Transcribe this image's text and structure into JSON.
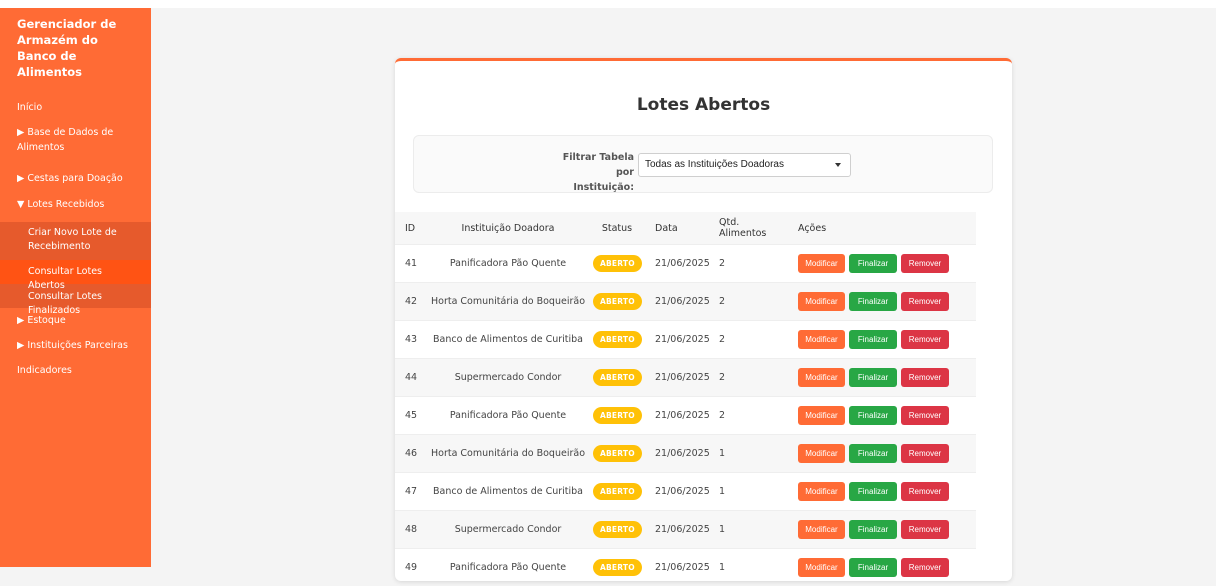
{
  "sidebar": {
    "brand": "Gerenciador de Armazém do Banco de Alimentos",
    "inicio": "Início",
    "base": "▶ Base de Dados de Alimentos",
    "cestas": "▶ Cestas para Doação",
    "lotes": "▼ Lotes Recebidos",
    "sub": [
      "Criar Novo Lote de Recebimento",
      "Consultar Lotes Abertos",
      "Consultar Lotes Finalizados"
    ],
    "estoque": "▶ Estoque",
    "instituicoes": "▶ Instituições Parceiras",
    "indicadores": "Indicadores"
  },
  "page": {
    "title": "Lotes Abertos",
    "filter_label": "Filtrar Tabela por Instituição:",
    "filter_value": "Todas as Instituições Doadoras"
  },
  "table": {
    "headers": [
      "ID",
      "Instituição Doadora",
      "Status",
      "Data",
      "Qtd. Alimentos",
      "Ações"
    ],
    "rows": [
      {
        "id": "41",
        "inst": "Panificadora Pão Quente",
        "status": "ABERTO",
        "data": "21/06/2025",
        "qtd": "2"
      },
      {
        "id": "42",
        "inst": "Horta Comunitária do Boqueirão",
        "status": "ABERTO",
        "data": "21/06/2025",
        "qtd": "2"
      },
      {
        "id": "43",
        "inst": "Banco de Alimentos de Curitiba",
        "status": "ABERTO",
        "data": "21/06/2025",
        "qtd": "2"
      },
      {
        "id": "44",
        "inst": "Supermercado Condor",
        "status": "ABERTO",
        "data": "21/06/2025",
        "qtd": "2"
      },
      {
        "id": "45",
        "inst": "Panificadora Pão Quente",
        "status": "ABERTO",
        "data": "21/06/2025",
        "qtd": "2"
      },
      {
        "id": "46",
        "inst": "Horta Comunitária do Boqueirão",
        "status": "ABERTO",
        "data": "21/06/2025",
        "qtd": "1"
      },
      {
        "id": "47",
        "inst": "Banco de Alimentos de Curitiba",
        "status": "ABERTO",
        "data": "21/06/2025",
        "qtd": "1"
      },
      {
        "id": "48",
        "inst": "Supermercado Condor",
        "status": "ABERTO",
        "data": "21/06/2025",
        "qtd": "1"
      },
      {
        "id": "49",
        "inst": "Panificadora Pão Quente",
        "status": "ABERTO",
        "data": "21/06/2025",
        "qtd": "1"
      }
    ],
    "actions": {
      "modify": "Modificar",
      "finalize": "Finalizar",
      "remove": "Remover"
    }
  },
  "colors": {
    "primary": "#ff6b35",
    "sidebar_submenu": "#e65a2c",
    "badge": "#ffc107",
    "success": "#28a745",
    "danger": "#dc3545"
  }
}
